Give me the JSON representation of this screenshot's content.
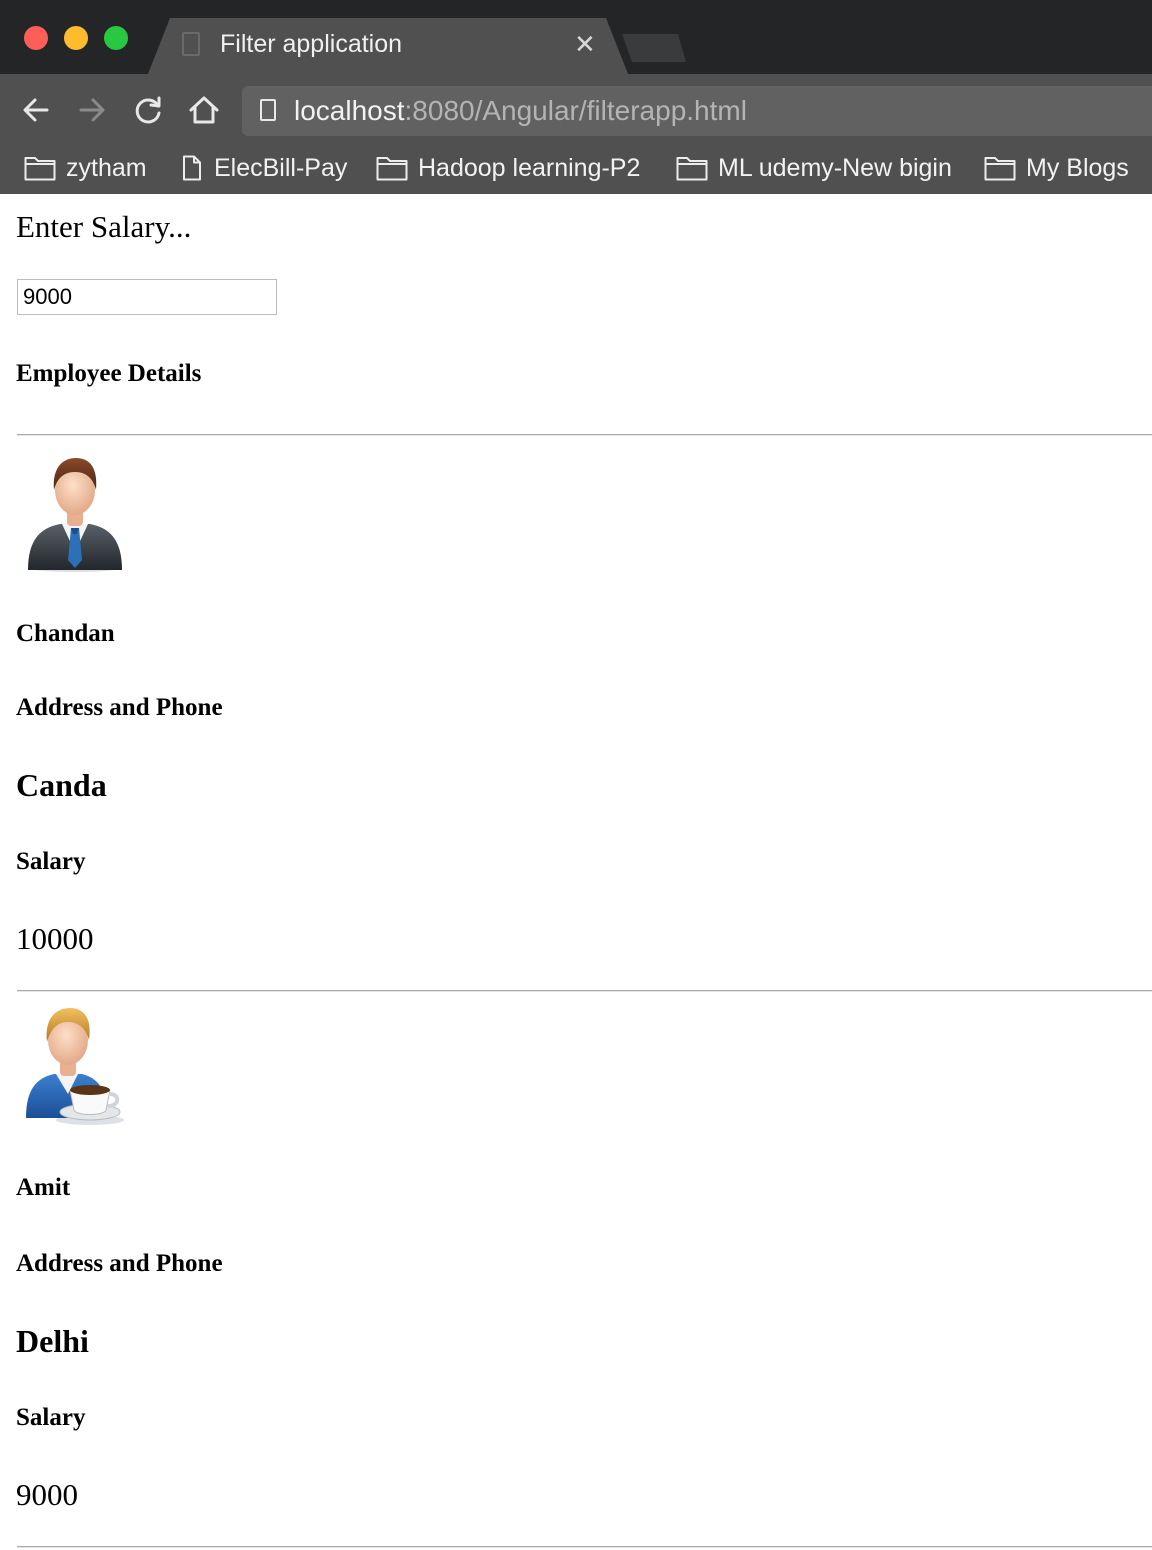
{
  "browser": {
    "tab_title": "Filter application",
    "tab_close": "✕",
    "url_host": "localhost",
    "url_path": ":8080/Angular/filterapp.html",
    "bookmarks": [
      {
        "label": "zytham",
        "icon": "folder-icon"
      },
      {
        "label": "ElecBill-Pay",
        "icon": "page-icon"
      },
      {
        "label": "Hadoop learning-P2",
        "icon": "folder-icon"
      },
      {
        "label": "ML udemy-New bigin",
        "icon": "folder-icon"
      },
      {
        "label": "My Blogs",
        "icon": "folder-icon"
      }
    ]
  },
  "page": {
    "prompt": "Enter Salary...",
    "salary_input_value": "9000",
    "section_title": "Employee Details",
    "employees": [
      {
        "name": "Chandan",
        "address_label": "Address and Phone",
        "city": "Canda",
        "salary_label": "Salary",
        "salary": "10000",
        "avatar": "businessman-avatar-icon"
      },
      {
        "name": "Amit",
        "address_label": "Address and Phone",
        "city": "Delhi",
        "salary_label": "Salary",
        "salary": "9000",
        "avatar": "coffee-man-avatar-icon"
      }
    ]
  }
}
